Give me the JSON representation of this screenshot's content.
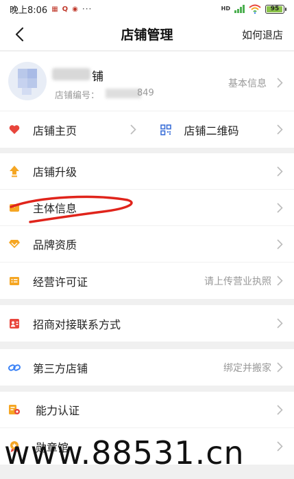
{
  "status_bar": {
    "time": "晚上8:06",
    "hd_label": "HD",
    "battery": "95"
  },
  "nav": {
    "title": "店铺管理",
    "right_link": "如何退店"
  },
  "shop": {
    "name_suffix": "铺",
    "id_label": "店铺编号：",
    "id_suffix": "849",
    "basic_info": "基本信息"
  },
  "quick": {
    "home": "店铺主页",
    "qrcode": "店铺二维码"
  },
  "menu_group_1": [
    {
      "label": "店铺升级",
      "value": "",
      "icon": "upgrade-arrow-icon"
    },
    {
      "label": "主体信息",
      "value": "",
      "icon": "entity-icon"
    },
    {
      "label": "品牌资质",
      "value": "",
      "icon": "brand-diamond-icon"
    },
    {
      "label": "经营许可证",
      "value": "请上传营业执照",
      "icon": "license-icon"
    }
  ],
  "menu_group_2": [
    {
      "label": "招商对接联系方式",
      "icon": "contact-card-icon"
    }
  ],
  "menu_group_3": [
    {
      "label": "第三方店铺",
      "value": "绑定并搬家",
      "icon": "link-icon"
    }
  ],
  "menu_group_4": [
    {
      "label": "能力认证",
      "icon": "certification-icon"
    },
    {
      "label": "勋章馆",
      "icon": "medal-icon"
    }
  ],
  "watermark": "www.88531.cn",
  "colors": {
    "accent_orange": "#f5a623",
    "heart_red": "#e8453c",
    "link_blue": "#3b82f6",
    "qr_blue": "#3b6fd8",
    "scribble_red": "#e0241b"
  }
}
